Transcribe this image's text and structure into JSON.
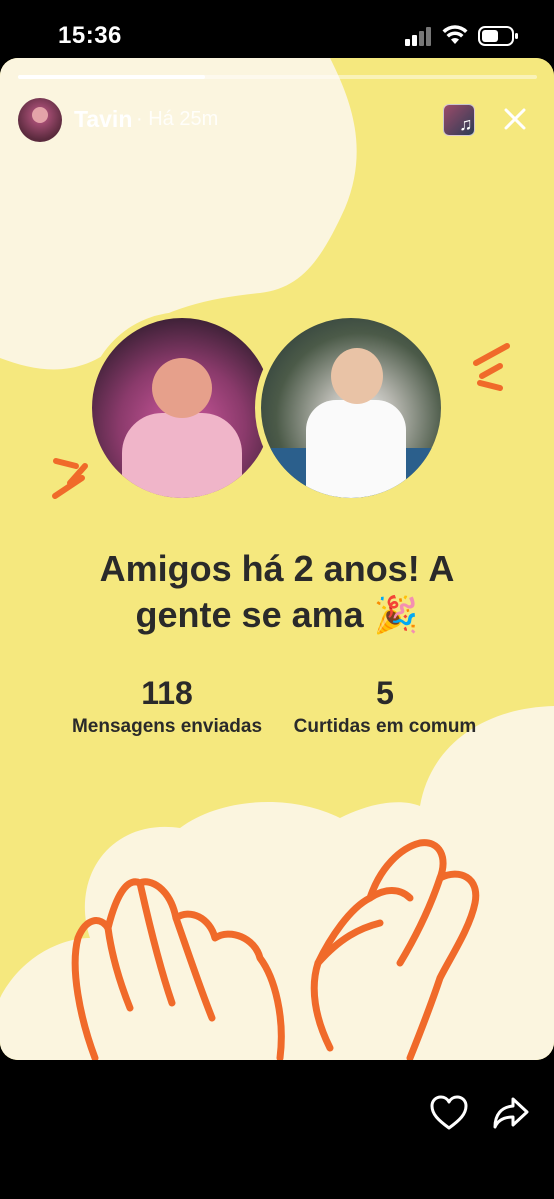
{
  "status_bar": {
    "time": "15:36"
  },
  "story": {
    "progress": 0.36,
    "username": "Tavin",
    "time_ago": "· Há 25m",
    "heading": "Amigos há 2 anos! A gente se ama 🎉",
    "stats": [
      {
        "value": "118",
        "label": "Mensagens enviadas"
      },
      {
        "value": "5",
        "label": "Curtidas em comum"
      }
    ]
  },
  "colors": {
    "background_yellow": "#F5E87E",
    "cream": "#FBF5DF",
    "accent_orange": "#F06A2A",
    "text_dark": "#2A2A2A"
  },
  "icons": [
    "signal-icon",
    "wifi-icon",
    "battery-icon",
    "music-note-icon",
    "close-icon",
    "heart-icon",
    "share-icon"
  ]
}
